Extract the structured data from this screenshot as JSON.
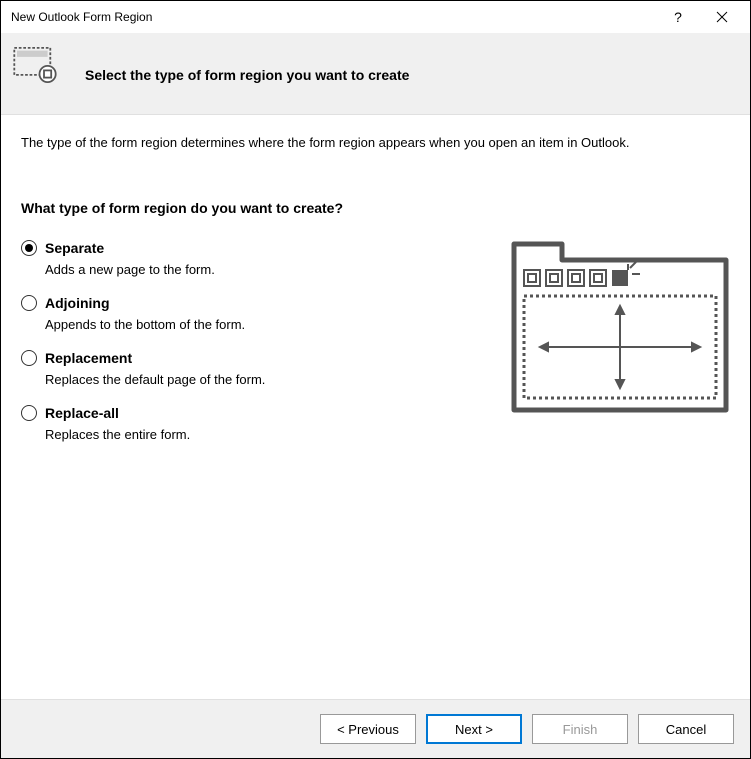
{
  "window": {
    "title": "New Outlook Form Region"
  },
  "header": {
    "title": "Select the type of form region you want to create"
  },
  "main": {
    "intro": "The type of the form region determines where the form region appears when you open an item in Outlook.",
    "question": "What type of form region do you want to create?",
    "options": [
      {
        "label": "Separate",
        "desc": "Adds a new page to the form.",
        "selected": true
      },
      {
        "label": "Adjoining",
        "desc": "Appends to the bottom of the form.",
        "selected": false
      },
      {
        "label": "Replacement",
        "desc": "Replaces the default page of the form.",
        "selected": false
      },
      {
        "label": "Replace-all",
        "desc": "Replaces the entire form.",
        "selected": false
      }
    ]
  },
  "footer": {
    "previous": "< Previous",
    "next": "Next >",
    "finish": "Finish",
    "cancel": "Cancel"
  }
}
